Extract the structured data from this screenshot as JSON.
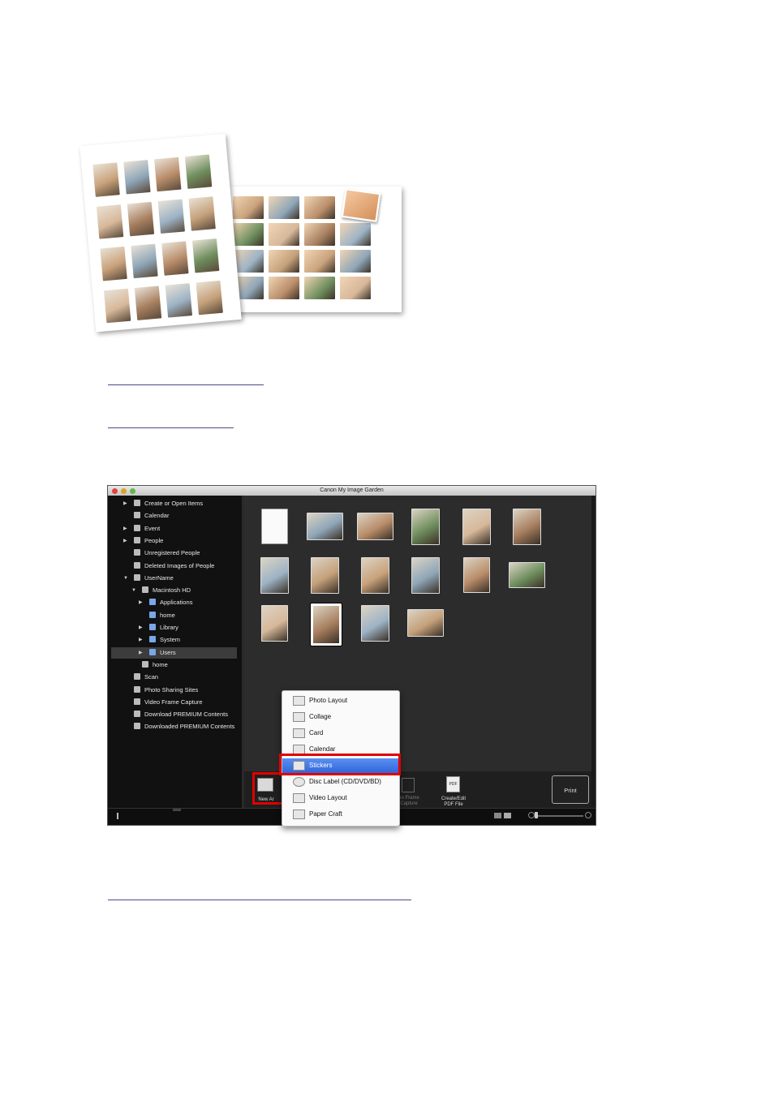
{
  "window": {
    "title": "Canon My Image Garden"
  },
  "sidebar": {
    "items": [
      {
        "label": "Create or Open Items",
        "icon": "create-icon",
        "arrow": "▶",
        "indent": 0
      },
      {
        "label": "Calendar",
        "icon": "calendar-icon",
        "arrow": "",
        "indent": 0
      },
      {
        "label": "Event",
        "icon": "event-icon",
        "arrow": "▶",
        "indent": 0
      },
      {
        "label": "People",
        "icon": "people-icon",
        "arrow": "▶",
        "indent": 0
      },
      {
        "label": "Unregistered People",
        "icon": "person-icon",
        "arrow": "",
        "indent": 0
      },
      {
        "label": "Deleted Images of People",
        "icon": "person-deleted-icon",
        "arrow": "",
        "indent": 0
      },
      {
        "label": "UserName",
        "icon": "computer-icon",
        "arrow": "▼",
        "indent": 0
      },
      {
        "label": "Macintosh HD",
        "icon": "drive-icon",
        "arrow": "▼",
        "indent": 1
      },
      {
        "label": "Applications",
        "icon": "folder-icon",
        "arrow": "▶",
        "indent": 2
      },
      {
        "label": "home",
        "icon": "folder-icon",
        "arrow": "",
        "indent": 2
      },
      {
        "label": "Library",
        "icon": "folder-icon",
        "arrow": "▶",
        "indent": 2
      },
      {
        "label": "System",
        "icon": "folder-icon",
        "arrow": "▶",
        "indent": 2
      },
      {
        "label": "Users",
        "icon": "folder-icon",
        "arrow": "▶",
        "indent": 2,
        "selected": true
      },
      {
        "label": "home",
        "icon": "drive-icon",
        "arrow": "",
        "indent": 1
      },
      {
        "label": "Scan",
        "icon": "scan-icon",
        "arrow": "",
        "indent": 0
      },
      {
        "label": "Photo Sharing Sites",
        "icon": "sharing-icon",
        "arrow": "",
        "indent": 0
      },
      {
        "label": "Video Frame Capture",
        "icon": "video-icon",
        "arrow": "",
        "indent": 0
      },
      {
        "label": "Download PREMIUM Contents",
        "icon": "download-icon",
        "arrow": "",
        "indent": 0
      },
      {
        "label": "Downloaded PREMIUM Contents",
        "icon": "downloaded-icon",
        "arrow": "",
        "indent": 0
      }
    ]
  },
  "toolbar": {
    "new_art_label": "New Ar",
    "video_frame_label_1": "eo Frame",
    "video_frame_label_2": "Capture",
    "create_pdf_label_1": "Create/Edit",
    "create_pdf_label_2": "PDF File",
    "pdf_badge": "PDF",
    "print_label": "Print"
  },
  "menu": {
    "items": [
      {
        "label": "Photo Layout",
        "icon": "photo-layout-icon"
      },
      {
        "label": "Collage",
        "icon": "collage-icon"
      },
      {
        "label": "Card",
        "icon": "card-icon"
      },
      {
        "label": "Calendar",
        "icon": "calendar-icon"
      },
      {
        "label": "Stickers",
        "icon": "stickers-icon",
        "highlighted": true
      },
      {
        "label": "Disc Label (CD/DVD/BD)",
        "icon": "disc-icon"
      },
      {
        "label": "Video Layout",
        "icon": "video-layout-icon"
      },
      {
        "label": "Paper Craft",
        "icon": "paper-craft-icon"
      }
    ]
  },
  "colors": {
    "highlight": "#e00000",
    "menu_selected": "#3a6fe0",
    "link": "#4a4a8a"
  }
}
